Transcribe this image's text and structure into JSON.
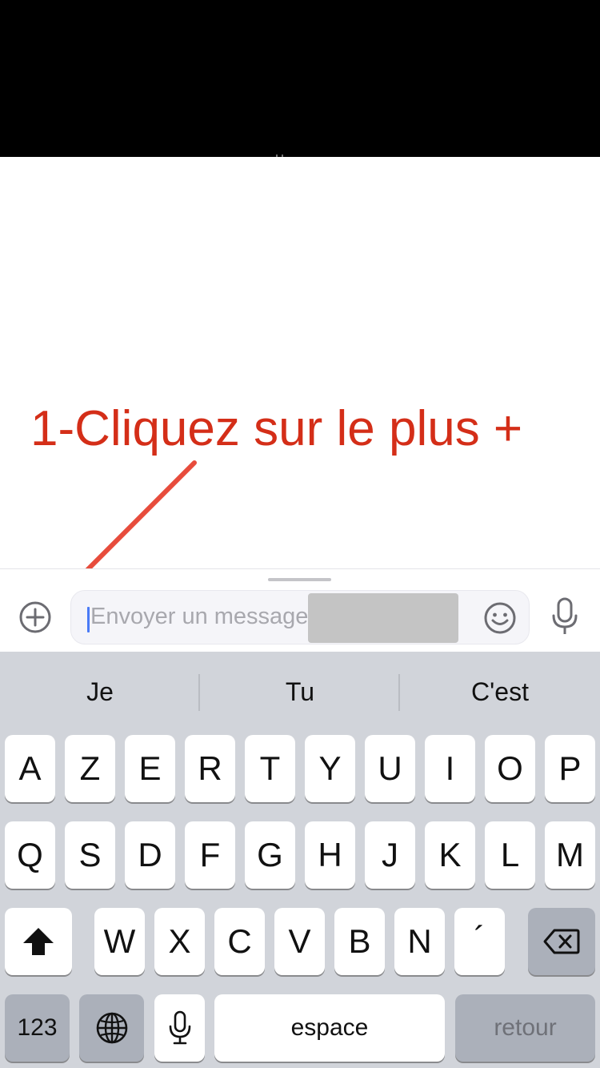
{
  "annotation": {
    "text": "1-Cliquez sur le plus +",
    "color": "#d42e18"
  },
  "composer": {
    "placeholder": "Envoyer un message",
    "icons": [
      "plus-circle-icon",
      "emoji-icon",
      "microphone-icon"
    ]
  },
  "keyboard": {
    "suggestions": [
      "Je",
      "Tu",
      "C'est"
    ],
    "row1": [
      "A",
      "Z",
      "E",
      "R",
      "T",
      "Y",
      "U",
      "I",
      "O",
      "P"
    ],
    "row2": [
      "Q",
      "S",
      "D",
      "F",
      "G",
      "H",
      "J",
      "K",
      "L",
      "M"
    ],
    "row3": [
      "W",
      "X",
      "C",
      "V",
      "B",
      "N",
      "´"
    ],
    "numbers_label": "123",
    "space_label": "espace",
    "return_label": "retour",
    "icons": [
      "shift-icon",
      "backspace-icon",
      "globe-icon",
      "dictation-icon"
    ]
  }
}
